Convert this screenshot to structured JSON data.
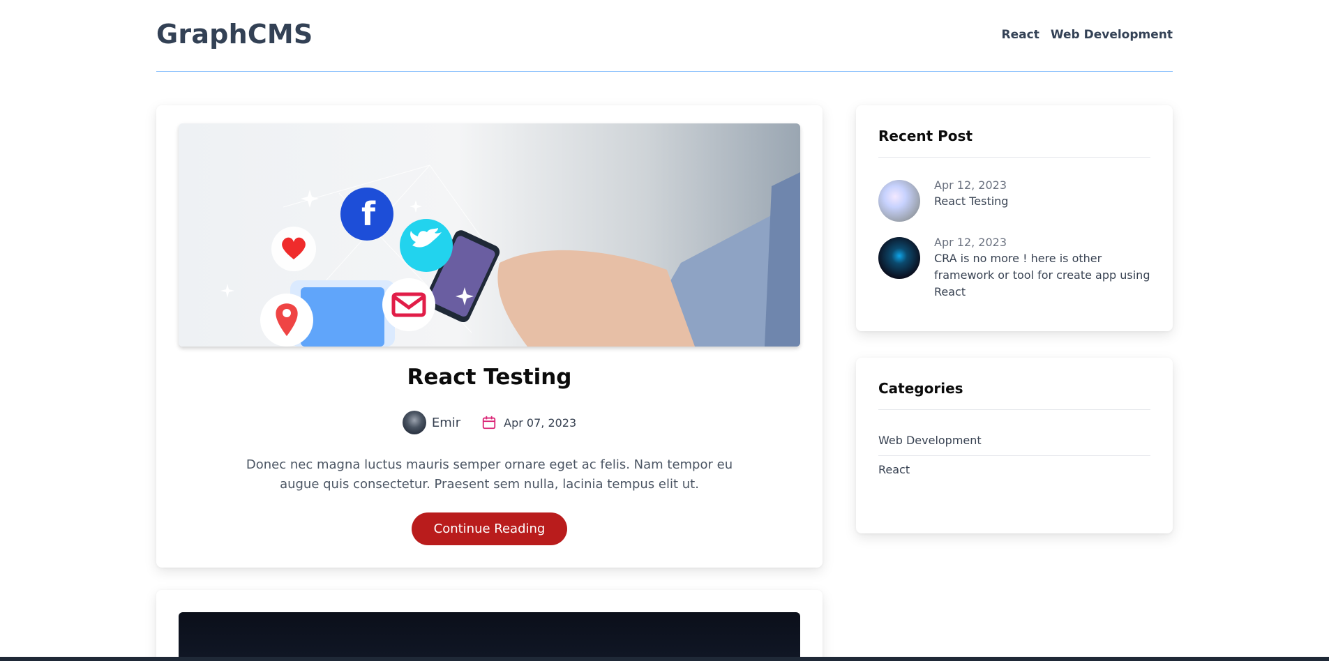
{
  "header": {
    "brand": "GraphCMS",
    "nav": [
      "React",
      "Web Development"
    ]
  },
  "post": {
    "title": "React Testing",
    "author": "Emir",
    "date": "Apr 07, 2023",
    "excerpt": "Donec nec magna luctus mauris semper ornare eget ac felis. Nam tempor eu augue quis consectetur. Praesent sem nulla, lacinia tempus elit ut.",
    "cta_label": "Continue Reading"
  },
  "recent": {
    "title": "Recent Post",
    "items": [
      {
        "date": "Apr 12, 2023",
        "title": "React Testing"
      },
      {
        "date": "Apr 12, 2023",
        "title": "CRA is no more ! here is other framework or tool for create app using React"
      }
    ]
  },
  "categories": {
    "title": "Categories",
    "items": [
      "Web Development",
      "React"
    ]
  },
  "colors": {
    "accent": "#b91c1c",
    "divider": "#93c5fd",
    "calendar_icon": "#db2777"
  }
}
